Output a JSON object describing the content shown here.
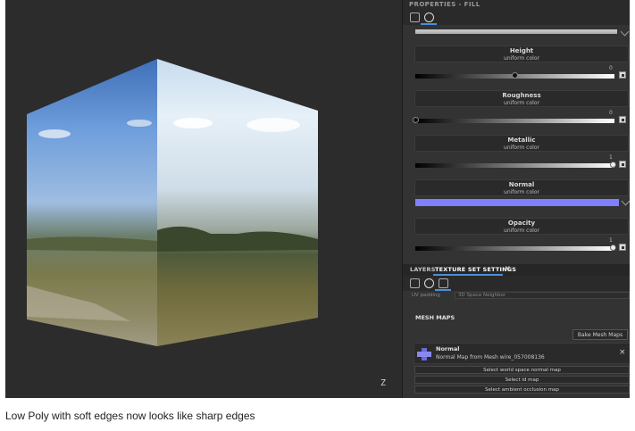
{
  "panel_header": "PROPERTIES - FILL",
  "channels": [
    {
      "name": "Height",
      "sub": "uniform color",
      "value": "0"
    },
    {
      "name": "Roughness",
      "sub": "uniform color",
      "value": "0"
    },
    {
      "name": "Metallic",
      "sub": "uniform color",
      "value": "1"
    },
    {
      "name": "Normal",
      "sub": "uniform color",
      "color": "#8080ff"
    },
    {
      "name": "Opacity",
      "sub": "uniform color",
      "value": "1"
    }
  ],
  "slider_levels": {
    "height": 0.5,
    "roughness": 0.0,
    "metallic": 1.0,
    "opacity": 1.0
  },
  "tabs": {
    "layers": "LAYERS",
    "texture_set_settings": "TEXTURE SET SETTINGS",
    "close": "×"
  },
  "uv_padding": {
    "label": "UV padding",
    "value": "3D Space Neighbor"
  },
  "mesh_maps": {
    "title": "MESH MAPS",
    "bake_button": "Bake Mesh Maps",
    "normal": {
      "name": "Normal",
      "sub": "Normal Map from Mesh wire_057008136",
      "close": "×"
    },
    "buttons": [
      "Select world space normal map",
      "Select id map",
      "Select ambient occlusion map"
    ]
  },
  "axis_label": "Z",
  "caption": "Low Poly with soft edges now looks like sharp edges"
}
